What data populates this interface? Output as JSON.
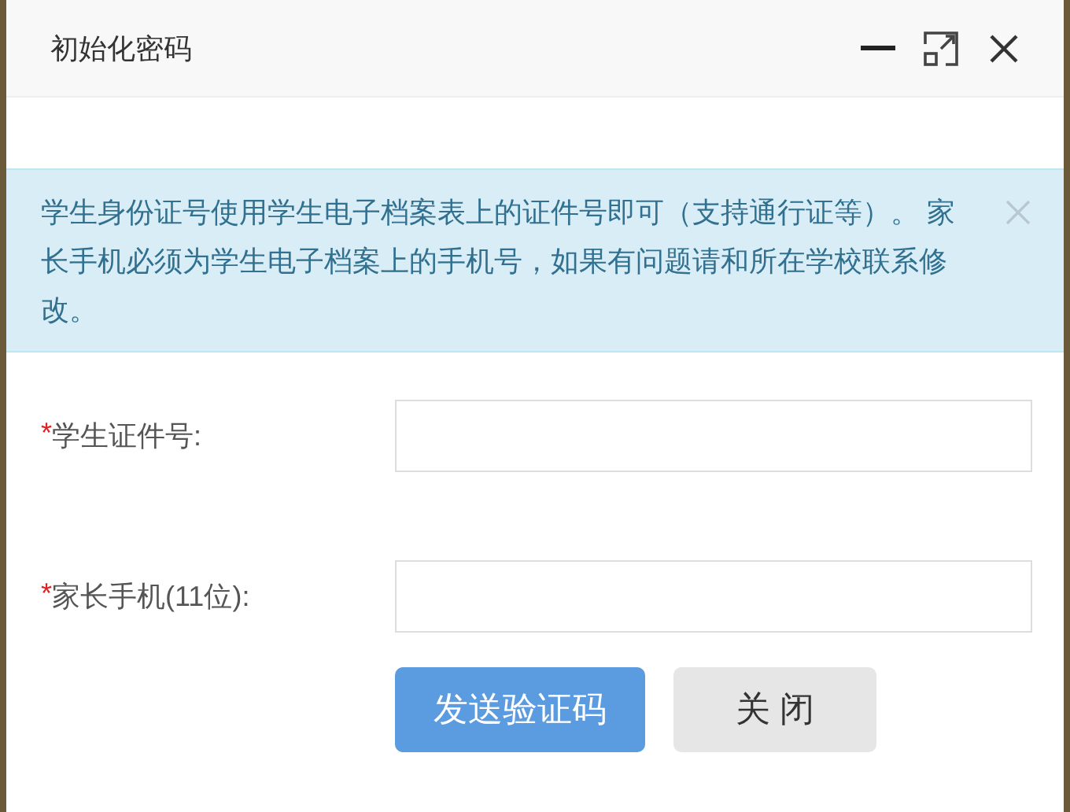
{
  "dialog": {
    "title": "初始化密码",
    "controls": [
      {
        "kind": "minimize"
      },
      {
        "kind": "maximize"
      },
      {
        "kind": "close"
      }
    ]
  },
  "alert": {
    "text": "学生身份证号使用学生电子档案表上的证件号即可（支持通行证等）。 家长手机必须为学生电子档案上的手机号，如果有问题请和所在学校联系修改。",
    "dismissible": true
  },
  "fields": [
    {
      "marker": "*",
      "label": "学生证件号:"
    },
    {
      "marker": "*",
      "label": "家长手机(11位):"
    }
  ],
  "buttons": [
    {
      "label": "发送验证码",
      "kind": "primary"
    },
    {
      "label": "关 闭",
      "kind": "secondary"
    }
  ]
}
